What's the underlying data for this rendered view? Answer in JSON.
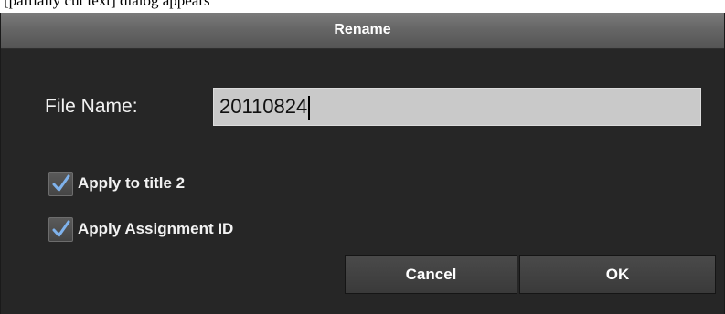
{
  "background_strip": {
    "text": "[partially cut text] dialog appears"
  },
  "dialog": {
    "title": "Rename",
    "file_name": {
      "label": "File Name:",
      "value": "20110824"
    },
    "options": [
      {
        "label": "Apply to title 2",
        "checked": true
      },
      {
        "label": "Apply Assignment ID",
        "checked": true
      }
    ],
    "buttons": {
      "cancel": "Cancel",
      "ok": "OK"
    }
  },
  "colors": {
    "dialog_bg": "#262626",
    "titlebar": "#666666",
    "input_bg": "#c9c9c9",
    "checkmark": "#7fb2ec"
  },
  "icons": {
    "checkmark": "checkmark-icon"
  }
}
